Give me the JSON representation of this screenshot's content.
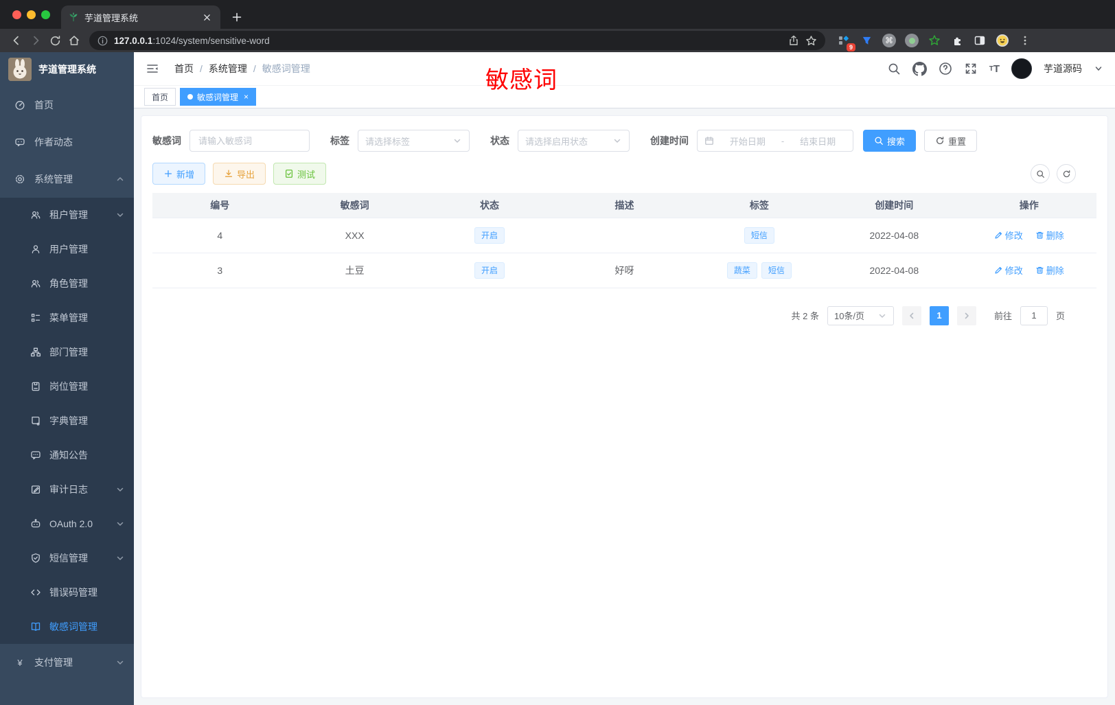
{
  "browser": {
    "tab_title": "芋道管理系统",
    "url_host": "127.0.0.1",
    "url_path": ":1024/system/sensitive-word",
    "extension_badge": "9"
  },
  "sidebar": {
    "app_title": "芋道管理系统",
    "items": [
      {
        "label": "首页"
      },
      {
        "label": "作者动态"
      },
      {
        "label": "系统管理"
      },
      {
        "label": "租户管理"
      },
      {
        "label": "用户管理"
      },
      {
        "label": "角色管理"
      },
      {
        "label": "菜单管理"
      },
      {
        "label": "部门管理"
      },
      {
        "label": "岗位管理"
      },
      {
        "label": "字典管理"
      },
      {
        "label": "通知公告"
      },
      {
        "label": "审计日志"
      },
      {
        "label": "OAuth 2.0"
      },
      {
        "label": "短信管理"
      },
      {
        "label": "错误码管理"
      },
      {
        "label": "敏感词管理"
      },
      {
        "label": "支付管理"
      }
    ]
  },
  "header": {
    "breadcrumb_home": "首页",
    "breadcrumb_sep": "/",
    "breadcrumb_section": "系统管理",
    "breadcrumb_current": "敏感词管理",
    "overlay_text": "敏感词",
    "username": "芋道源码"
  },
  "tabs": {
    "home": "首页",
    "current": "敏感词管理",
    "close": "×"
  },
  "filters": {
    "keyword_label": "敏感词",
    "keyword_placeholder": "请输入敏感词",
    "tag_label": "标签",
    "tag_placeholder": "请选择标签",
    "status_label": "状态",
    "status_placeholder": "请选择启用状态",
    "date_label": "创建时间",
    "date_start": "开始日期",
    "date_sep": "-",
    "date_end": "结束日期",
    "search_label": "搜索",
    "reset_label": "重置"
  },
  "toolbar": {
    "add_label": "新增",
    "export_label": "导出",
    "test_label": "测试"
  },
  "table": {
    "columns": [
      "编号",
      "敏感词",
      "状态",
      "描述",
      "标签",
      "创建时间",
      "操作"
    ],
    "edit_label": "修改",
    "delete_label": "删除",
    "rows": [
      {
        "id": "4",
        "word": "XXX",
        "status": "开启",
        "description": "",
        "tags": [
          "短信"
        ],
        "created": "2022-04-08"
      },
      {
        "id": "3",
        "word": "土豆",
        "status": "开启",
        "description": "好呀",
        "tags": [
          "蔬菜",
          "短信"
        ],
        "created": "2022-04-08"
      }
    ]
  },
  "pagination": {
    "total": "共 2 条",
    "page_size": "10条/页",
    "page": "1",
    "goto_label": "前往",
    "goto_value": "1",
    "unit_label": "页"
  },
  "colors": {
    "accent": "#409eff",
    "overlay_red": "#fe0000",
    "warning": "#e6a23c",
    "success": "#67c23a",
    "sidebar_bg": "#37495e",
    "submenu_bg": "#2b3a4d"
  }
}
